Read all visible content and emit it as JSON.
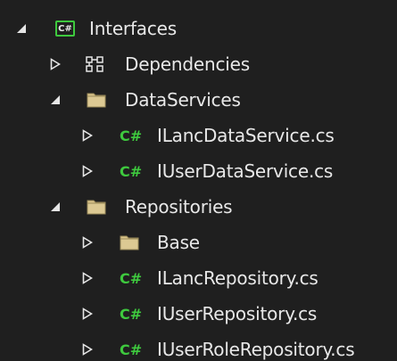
{
  "tree": {
    "project": {
      "label": "Interfaces",
      "icon_text": "C#",
      "icon": "csharp-project-icon",
      "expanded": true
    },
    "dependencies": {
      "label": "Dependencies",
      "icon": "dependencies-icon",
      "expanded": false
    },
    "data_services": {
      "label": "DataServices",
      "icon": "folder-icon",
      "expanded": true,
      "files": [
        {
          "label": "ILancDataService.cs",
          "icon_text": "C#"
        },
        {
          "label": "IUserDataService.cs",
          "icon_text": "C#"
        }
      ]
    },
    "repositories": {
      "label": "Repositories",
      "icon": "folder-icon",
      "expanded": true,
      "base_folder": {
        "label": "Base",
        "icon": "folder-icon",
        "expanded": false
      },
      "files": [
        {
          "label": "ILancRepository.cs",
          "icon_text": "C#"
        },
        {
          "label": "IUserRepository.cs",
          "icon_text": "C#"
        },
        {
          "label": "IUserRoleRepository.cs",
          "icon_text": "C#"
        }
      ]
    }
  },
  "colors": {
    "background": "#1f1f1f",
    "text": "#e8e8e8",
    "csharp_green": "#3ec93e",
    "folder_fill": "#d9c48a",
    "folder_dark": "#b9a46a"
  }
}
